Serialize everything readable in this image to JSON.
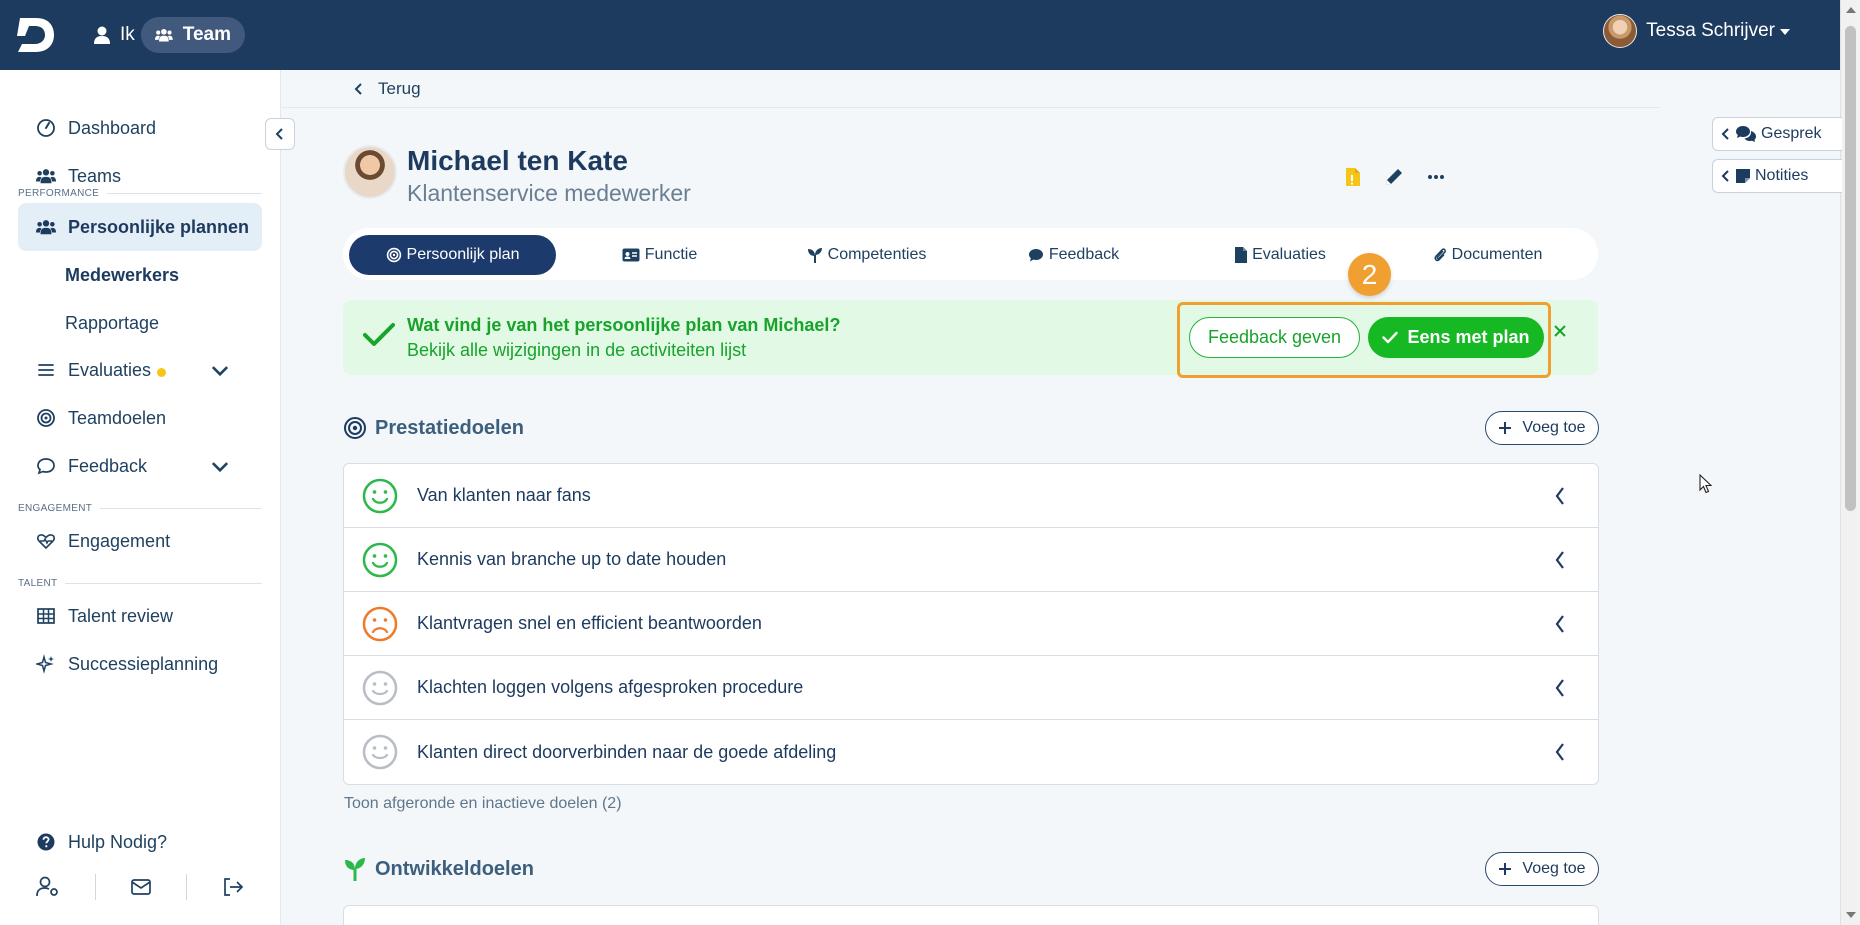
{
  "topbar": {
    "logo_letter": "D",
    "tab_me": "Ik",
    "tab_team": "Team",
    "user_name": "Tessa Schrijver"
  },
  "sidebar": {
    "dashboard": "Dashboard",
    "teams": "Teams",
    "section_performance": "PERFORMANCE",
    "persoonlijke_plannen": "Persoonlijke plannen",
    "medewerkers": "Medewerkers",
    "rapportage": "Rapportage",
    "evaluaties": "Evaluaties",
    "teamdoelen": "Teamdoelen",
    "feedback": "Feedback",
    "section_engagement": "ENGAGEMENT",
    "engagement": "Engagement",
    "section_talent": "TALENT",
    "talent_review": "Talent review",
    "successieplanning": "Successieplanning",
    "help": "Hulp Nodig?"
  },
  "main": {
    "back": "Terug",
    "name": "Michael ten Kate",
    "role": "Klantenservice medewerker",
    "tabs": [
      {
        "label": "Persoonlijk plan"
      },
      {
        "label": "Functie"
      },
      {
        "label": "Competenties"
      },
      {
        "label": "Feedback"
      },
      {
        "label": "Evaluaties"
      },
      {
        "label": "Documenten"
      }
    ],
    "banner": {
      "title": "Wat vind je van het persoonlijke plan van Michael?",
      "subtitle": "Bekijk alle wijzigingen in de activiteiten lijst",
      "feedback_btn": "Feedback geven",
      "agree_btn": "Eens met plan",
      "step": "2"
    },
    "prestatie": {
      "title": "Prestatiedoelen",
      "add": "Voeg toe",
      "goals": [
        {
          "label": "Van klanten naar fans",
          "status": "happy"
        },
        {
          "label": "Kennis van branche up to date houden",
          "status": "happy"
        },
        {
          "label": "Klantvragen snel en efficient beantwoorden",
          "status": "sad"
        },
        {
          "label": "Klachten loggen volgens afgesproken procedure",
          "status": "neutral"
        },
        {
          "label": "Klanten direct doorverbinden naar de goede afdeling",
          "status": "neutral"
        }
      ],
      "show_more": "Toon afgeronde en inactieve doelen (2)"
    },
    "ontwikkel": {
      "title": "Ontwikkeldoelen",
      "add": "Voeg toe"
    }
  },
  "right_panel": {
    "gesprek": "Gesprek",
    "notities": "Notities"
  },
  "colors": {
    "topbar": "#1d3a5f",
    "accent_green": "#16b824",
    "highlight": "#f0a030",
    "face_happy": "#2cb84a",
    "face_sad": "#f07a2a",
    "face_neutral": "#b8bec6"
  }
}
